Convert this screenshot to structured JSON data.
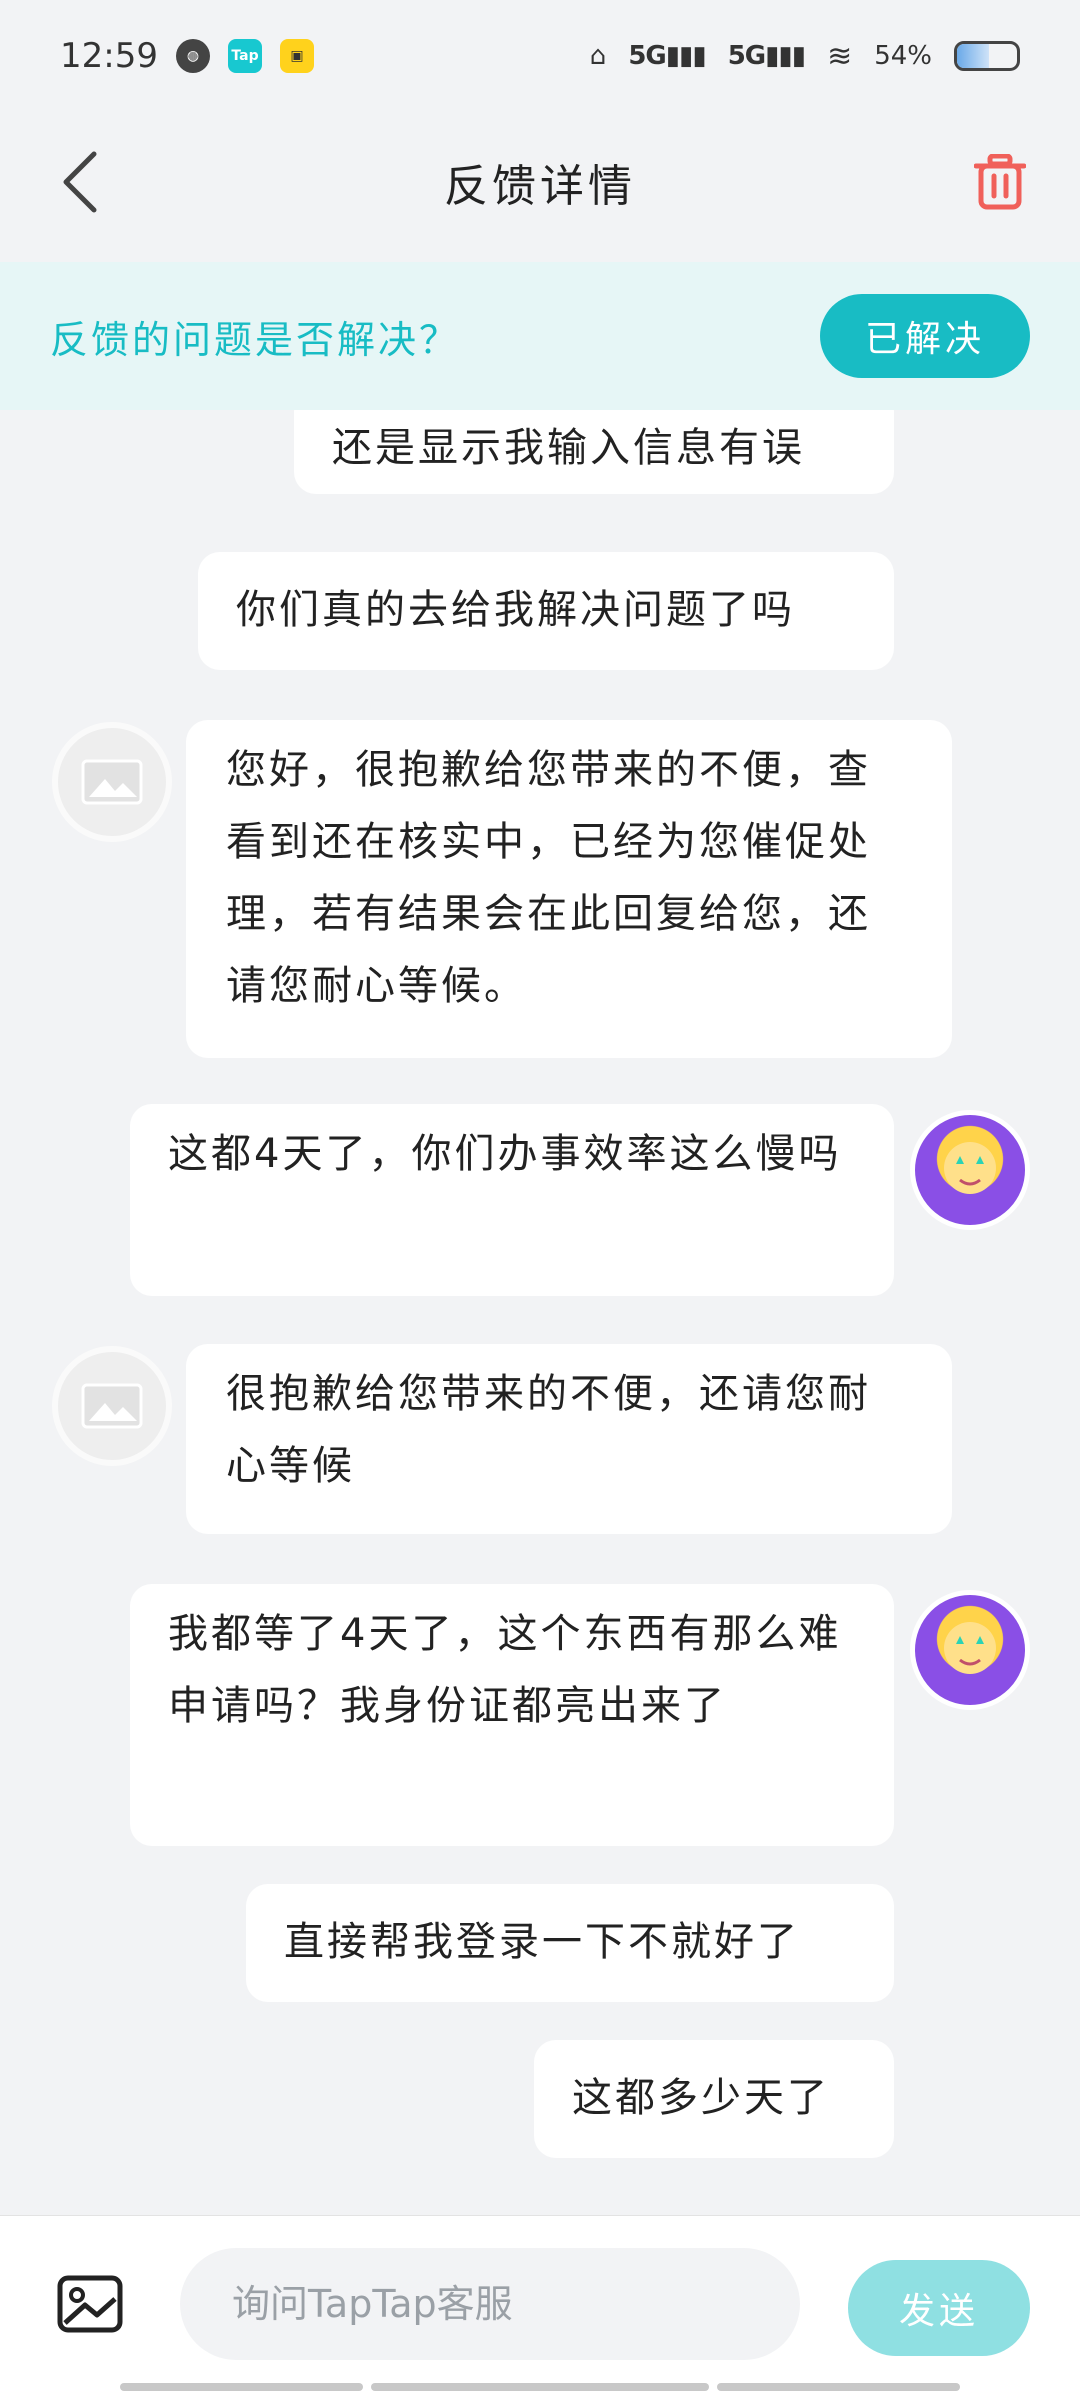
{
  "status_bar": {
    "time": "12:59",
    "network1": "5G",
    "network2": "5G",
    "battery": "54%",
    "battery_level": 0.54
  },
  "header": {
    "title": "反馈详情"
  },
  "banner": {
    "question": "反馈的问题是否解决？",
    "resolved_label": "已解决"
  },
  "messages": [
    {
      "sender": "user",
      "text": "还是显示我输入信息有误"
    },
    {
      "sender": "user",
      "text": "你们真的去给我解决问题了吗"
    },
    {
      "sender": "support",
      "text": "您好，很抱歉给您带来的不便，查看到还在核实中，已经为您催促处理，若有结果会在此回复给您，还请您耐心等候。"
    },
    {
      "sender": "user",
      "text": "这都4天了，你们办事效率这么慢吗"
    },
    {
      "sender": "support",
      "text": "很抱歉给您带来的不便，还请您耐心等候"
    },
    {
      "sender": "user",
      "text": "我都等了4天了，这个东西有那么难申请吗？我身份证都亮出来了"
    },
    {
      "sender": "user",
      "text": "直接帮我登录一下不就好了"
    },
    {
      "sender": "user",
      "text": "这都多少天了"
    }
  ],
  "input_bar": {
    "placeholder": "询问TapTap客服",
    "send_label": "发送"
  },
  "colors": {
    "accent": "#18bcc4",
    "banner_bg": "#e6f6f6",
    "send_disabled": "#8fe0e2",
    "trash": "#f0605a"
  }
}
